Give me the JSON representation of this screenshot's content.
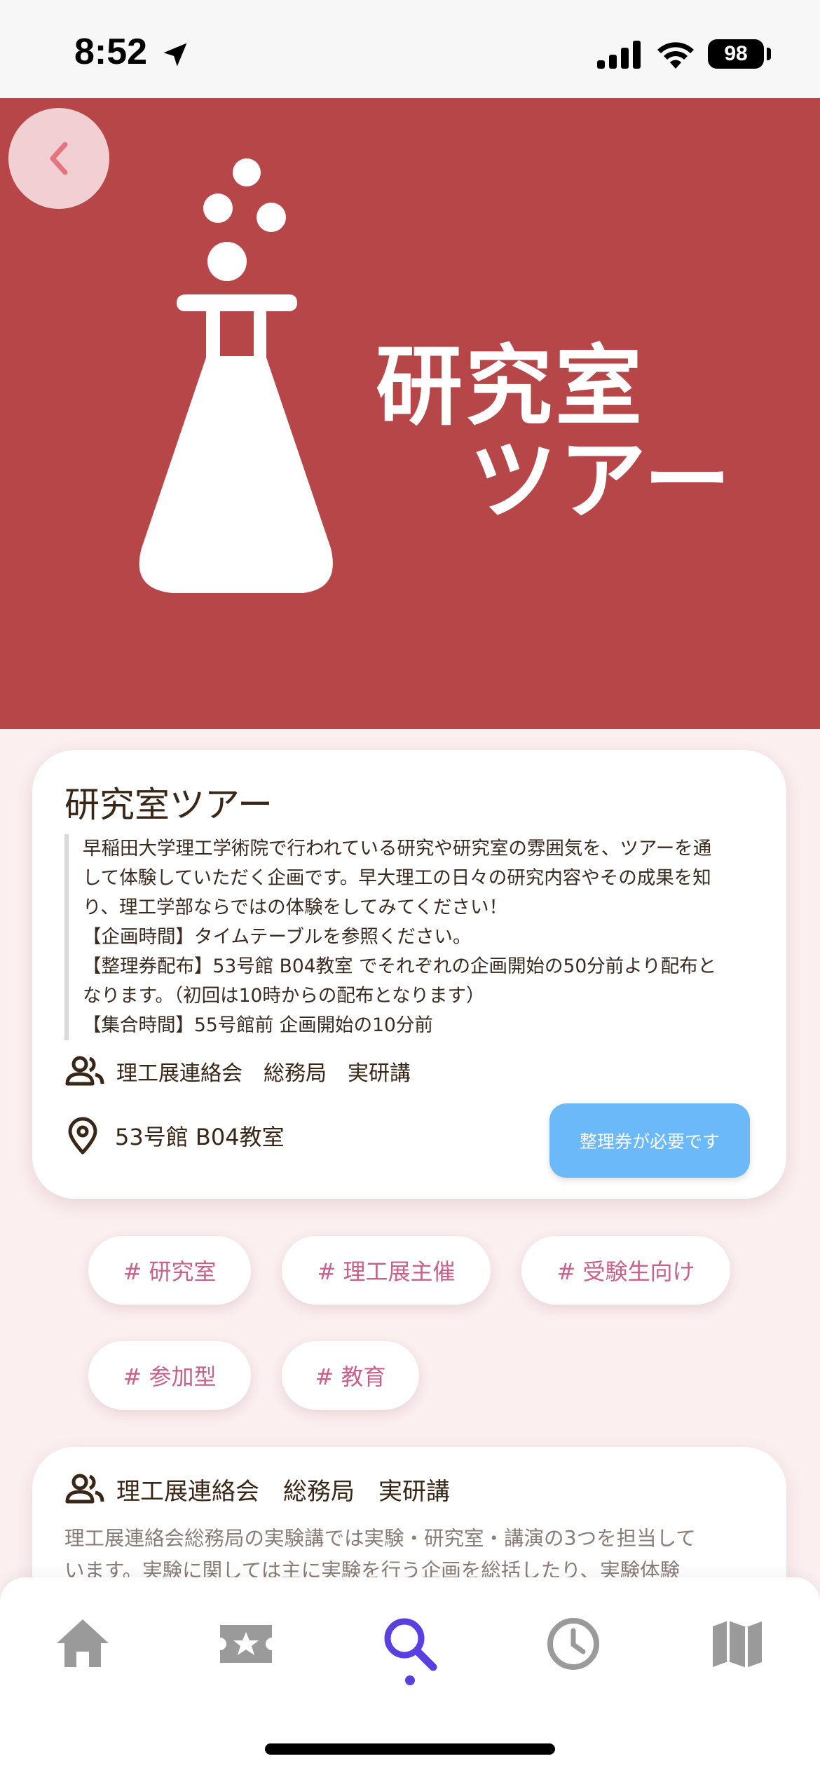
{
  "status_bar": {
    "time": "8:52",
    "battery": "98"
  },
  "hero": {
    "title_line1": "研究室",
    "title_line2": "ツアー"
  },
  "event": {
    "title": "研究室ツアー",
    "description_lines": [
      "早稲田大学理工学術院で行われている研究や研究室の雰囲気を、ツアーを通",
      "して体験していただく企画です。早大理工の日々の研究内容やその成果を知",
      "り、理工学部ならではの体験をしてみてください！",
      "【企画時間】タイムテーブルを参照ください。",
      "【整理券配布】53号館 B04教室 でそれぞれの企画開始の50分前より配布と",
      "なります。（初回は10時からの配布となります）",
      "【集合時間】55号館前 企画開始の10分前"
    ],
    "organizer": "理工展連絡会　総務局　実研講",
    "location": "53号館 B04教室",
    "ticket_label": "整理券が必要です"
  },
  "tags": [
    "# 研究室",
    "# 理工展主催",
    "# 受験生向け",
    "# 参加型",
    "# 教育"
  ],
  "organizer_card": {
    "name": "理工展連絡会　総務局　実研講",
    "description_lines": [
      "理工展連絡会総務局の実験講では実験・研究室・講演の3つを担当して",
      "います。実験に関しては主に実験を行う企画を総括したり、実験体験"
    ]
  },
  "tab_bar": {
    "items": [
      "home",
      "favorites",
      "search",
      "timetable",
      "map"
    ],
    "active": "search"
  },
  "colors": {
    "hero": "#b64648",
    "accent": "#5b3fe0",
    "tag_text": "#c8618a",
    "ticket_button": "#6cb9f9",
    "back_button": "#f1cfd2"
  }
}
